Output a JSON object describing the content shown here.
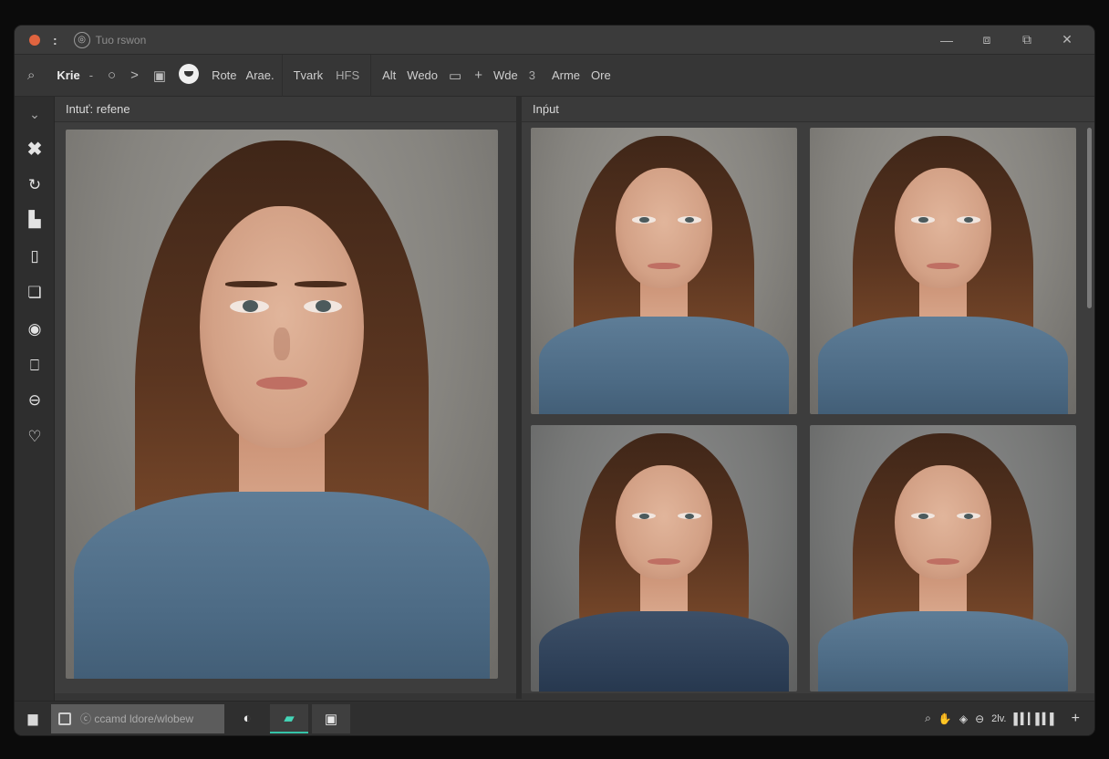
{
  "titlebar": {
    "menu_glyph": ":",
    "title": "Tuo rswon",
    "minimize": "—",
    "restore": "⧈",
    "maximize": "⧉",
    "close": "✕"
  },
  "toolbar": {
    "items": [
      "Krie",
      "-",
      "○",
      ">",
      "▣",
      "",
      "Rote",
      "Arae.",
      "Tvark",
      "HFS",
      "Alt",
      "Wedo",
      "▭",
      "+",
      "Wde",
      "3",
      "Arme",
      "Ore"
    ]
  },
  "rail": {
    "collapse": "⌄",
    "icons": [
      "close-icon",
      "lasso-icon",
      "save-icon",
      "rectangle-icon",
      "layers-icon",
      "info-icon",
      "crop-icon",
      "minus-circle-icon",
      "heart-icon"
    ]
  },
  "panels": {
    "left_title": "Intuť: refene",
    "right_title": "Inṕut"
  },
  "statusbar": {
    "path_text": "ⓒ ccamd ldore/wlobew",
    "zoom": "2lv.",
    "right_glyphs": [
      "⌕",
      "✋",
      "◈",
      "⊖"
    ],
    "plus": "+"
  }
}
